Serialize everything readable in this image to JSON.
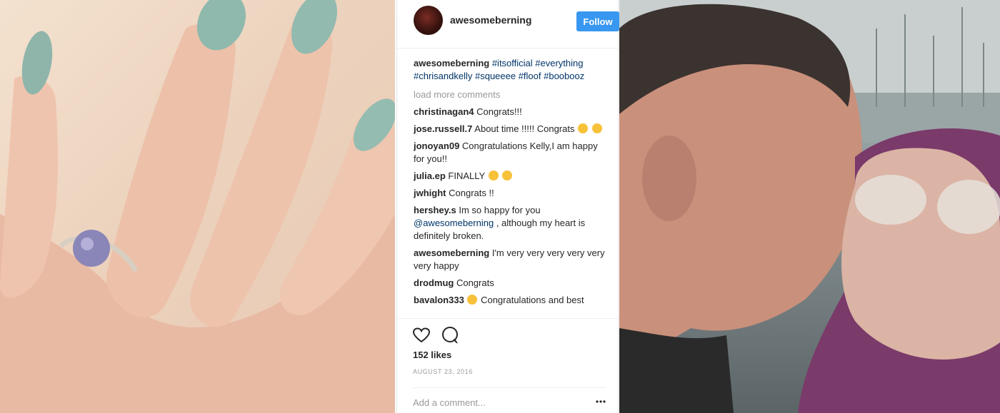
{
  "post": {
    "username": "awesomeberning",
    "follow_label": "Follow",
    "caption": {
      "user": "awesomeberning",
      "hashtags": "#itsofficial #everything #chrisandkelly #squeeee #floof #boobooz"
    },
    "load_more": "load more comments",
    "comments": [
      {
        "user": "christinagan4",
        "text": "Congrats!!!"
      },
      {
        "user": "jose.russell.7",
        "text": "About time !!!!! Congrats"
      },
      {
        "user": "jonoyan09",
        "text": "Congratulations Kelly,I am happy for you!!"
      },
      {
        "user": "julia.ep",
        "text": "FINALLY"
      },
      {
        "user": "jwhight",
        "text": "Congrats !!"
      },
      {
        "user": "hershey.s",
        "text": "Im so happy for you",
        "mention": "@awesomeberning",
        "text_after": ", although my heart is definitely broken."
      },
      {
        "user": "awesomeberning",
        "text": "I'm very very very very very very happy"
      },
      {
        "user": "drodmug",
        "text": "Congrats"
      },
      {
        "user": "bavalon333",
        "text": "Congratulations and best"
      }
    ],
    "likes": "152 likes",
    "date": "AUGUST 23, 2016",
    "add_comment_placeholder": "Add a comment...",
    "accent_color": "#3897f0",
    "hashtag_color": "#003569"
  },
  "icons": {
    "like": "heart-icon",
    "comment": "speech-bubble-icon",
    "more": "ellipsis-icon"
  }
}
